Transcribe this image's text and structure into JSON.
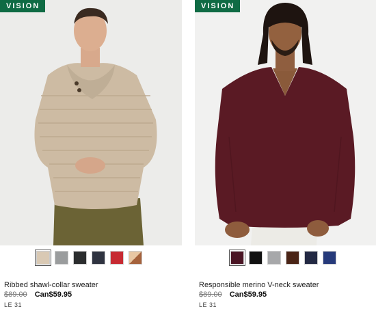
{
  "products": [
    {
      "badge": "VISION",
      "name": "Ribbed shawl-collar sweater",
      "old_price": "$89.00",
      "new_price": "Can$59.95",
      "size_note": "LE 31",
      "swatches": [
        "#d9c9b4",
        "#9a9c9d",
        "#2b2d2e",
        "#2f3340",
        "#c72a32",
        "#c98a5c"
      ],
      "selected_swatch": 0
    },
    {
      "badge": "VISION",
      "name": "Responsible merino V-neck sweater",
      "old_price": "$89.00",
      "new_price": "Can$59.95",
      "size_note": "LE 31",
      "swatches": [
        "#4a1524",
        "#111111",
        "#a7a8aa",
        "#4a2416",
        "#232943",
        "#263a7a"
      ],
      "selected_swatch": 0
    }
  ]
}
